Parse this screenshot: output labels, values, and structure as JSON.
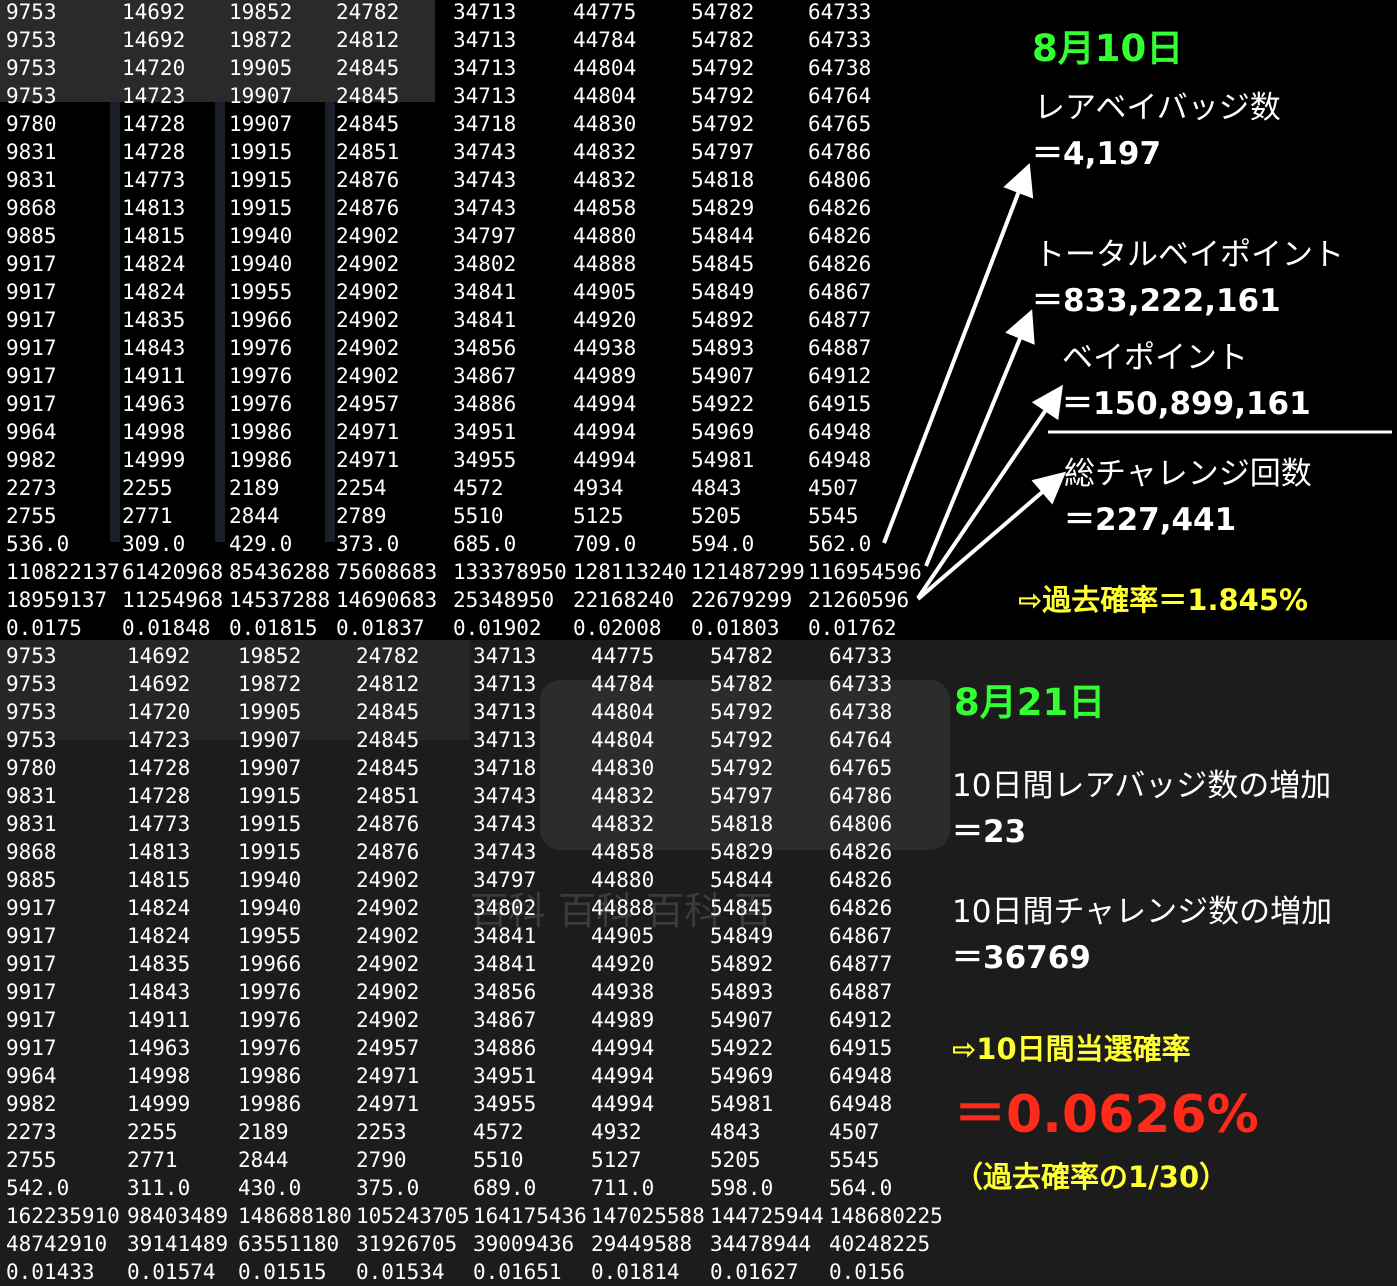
{
  "top_table": {
    "rows": [
      [
        "9753",
        "14692",
        "19852",
        "24782",
        "34713",
        "44775",
        "54782",
        "64733"
      ],
      [
        "9753",
        "14692",
        "19872",
        "24812",
        "34713",
        "44784",
        "54782",
        "64733"
      ],
      [
        "9753",
        "14720",
        "19905",
        "24845",
        "34713",
        "44804",
        "54792",
        "64738"
      ],
      [
        "9753",
        "14723",
        "19907",
        "24845",
        "34713",
        "44804",
        "54792",
        "64764"
      ],
      [
        "9780",
        "14728",
        "19907",
        "24845",
        "34718",
        "44830",
        "54792",
        "64765"
      ],
      [
        "9831",
        "14728",
        "19915",
        "24851",
        "34743",
        "44832",
        "54797",
        "64786"
      ],
      [
        "9831",
        "14773",
        "19915",
        "24876",
        "34743",
        "44832",
        "54818",
        "64806"
      ],
      [
        "9868",
        "14813",
        "19915",
        "24876",
        "34743",
        "44858",
        "54829",
        "64826"
      ],
      [
        "9885",
        "14815",
        "19940",
        "24902",
        "34797",
        "44880",
        "54844",
        "64826"
      ],
      [
        "9917",
        "14824",
        "19940",
        "24902",
        "34802",
        "44888",
        "54845",
        "64826"
      ],
      [
        "9917",
        "14824",
        "19955",
        "24902",
        "34841",
        "44905",
        "54849",
        "64867"
      ],
      [
        "9917",
        "14835",
        "19966",
        "24902",
        "34841",
        "44920",
        "54892",
        "64877"
      ],
      [
        "9917",
        "14843",
        "19976",
        "24902",
        "34856",
        "44938",
        "54893",
        "64887"
      ],
      [
        "9917",
        "14911",
        "19976",
        "24902",
        "34867",
        "44989",
        "54907",
        "64912"
      ],
      [
        "9917",
        "14963",
        "19976",
        "24957",
        "34886",
        "44994",
        "54922",
        "64915"
      ],
      [
        "9964",
        "14998",
        "19986",
        "24971",
        "34951",
        "44994",
        "54969",
        "64948"
      ],
      [
        "9982",
        "14999",
        "19986",
        "24971",
        "34955",
        "44994",
        "54981",
        "64948"
      ],
      [
        "2273",
        "2255",
        "2189",
        "2254",
        "4572",
        "4934",
        "4843",
        "4507"
      ],
      [
        "2755",
        "2771",
        "2844",
        "2789",
        "5510",
        "5125",
        "5205",
        "5545"
      ],
      [
        "536.0",
        "309.0",
        "429.0",
        "373.0",
        "685.0",
        "709.0",
        "594.0",
        "562.0"
      ],
      [
        "110822137",
        "61420968",
        "85436288",
        "75608683",
        "133378950",
        "128113240",
        "121487299",
        "116954596"
      ],
      [
        "18959137",
        "11254968",
        "14537288",
        "14690683",
        "25348950",
        "22168240",
        "22679299",
        "21260596"
      ],
      [
        "0.0175",
        "0.01848",
        "0.01815",
        "0.01837",
        "0.01902",
        "0.02008",
        "0.01803",
        "0.01762"
      ]
    ]
  },
  "bottom_table": {
    "rows": [
      [
        "9753",
        "14692",
        "19852",
        "24782",
        "34713",
        "44775",
        "54782",
        "64733"
      ],
      [
        "9753",
        "14692",
        "19872",
        "24812",
        "34713",
        "44784",
        "54782",
        "64733"
      ],
      [
        "9753",
        "14720",
        "19905",
        "24845",
        "34713",
        "44804",
        "54792",
        "64738"
      ],
      [
        "9753",
        "14723",
        "19907",
        "24845",
        "34713",
        "44804",
        "54792",
        "64764"
      ],
      [
        "9780",
        "14728",
        "19907",
        "24845",
        "34718",
        "44830",
        "54792",
        "64765"
      ],
      [
        "9831",
        "14728",
        "19915",
        "24851",
        "34743",
        "44832",
        "54797",
        "64786"
      ],
      [
        "9831",
        "14773",
        "19915",
        "24876",
        "34743",
        "44832",
        "54818",
        "64806"
      ],
      [
        "9868",
        "14813",
        "19915",
        "24876",
        "34743",
        "44858",
        "54829",
        "64826"
      ],
      [
        "9885",
        "14815",
        "19940",
        "24902",
        "34797",
        "44880",
        "54844",
        "64826"
      ],
      [
        "9917",
        "14824",
        "19940",
        "24902",
        "34802",
        "44888",
        "54845",
        "64826"
      ],
      [
        "9917",
        "14824",
        "19955",
        "24902",
        "34841",
        "44905",
        "54849",
        "64867"
      ],
      [
        "9917",
        "14835",
        "19966",
        "24902",
        "34841",
        "44920",
        "54892",
        "64877"
      ],
      [
        "9917",
        "14843",
        "19976",
        "24902",
        "34856",
        "44938",
        "54893",
        "64887"
      ],
      [
        "9917",
        "14911",
        "19976",
        "24902",
        "34867",
        "44989",
        "54907",
        "64912"
      ],
      [
        "9917",
        "14963",
        "19976",
        "24957",
        "34886",
        "44994",
        "54922",
        "64915"
      ],
      [
        "9964",
        "14998",
        "19986",
        "24971",
        "34951",
        "44994",
        "54969",
        "64948"
      ],
      [
        "9982",
        "14999",
        "19986",
        "24971",
        "34955",
        "44994",
        "54981",
        "64948"
      ],
      [
        "2273",
        "2255",
        "2189",
        "2253",
        "4572",
        "4932",
        "4843",
        "4507"
      ],
      [
        "2755",
        "2771",
        "2844",
        "2790",
        "5510",
        "5127",
        "5205",
        "5545"
      ],
      [
        "542.0",
        "311.0",
        "430.0",
        "375.0",
        "689.0",
        "711.0",
        "598.0",
        "564.0"
      ],
      [
        "162235910",
        "98403489",
        "148688180",
        "105243705",
        "164175436",
        "147025588",
        "144725944",
        "148680225"
      ],
      [
        "48742910",
        "39141489",
        "63551180",
        "31926705",
        "39009436",
        "29449588",
        "34478944",
        "40248225"
      ],
      [
        "0.01433",
        "0.01574",
        "0.01515",
        "0.01534",
        "0.01651",
        "0.01814",
        "0.01627",
        "0.0156"
      ]
    ]
  },
  "top_annotations": {
    "date": "8月10日",
    "rare_badge_label": "レアベイバッジ数",
    "rare_badge_value": "＝4,197",
    "total_points_label": "トータルベイポイント",
    "total_points_value": "＝833,222,161",
    "points_label": "ベイポイント",
    "points_value": "＝150,899,161",
    "challenges_label": "総チャレンジ回数",
    "challenges_value": "＝227,441",
    "past_prob": "⇨過去確率＝1.845%"
  },
  "bottom_annotations": {
    "date": "8月21日",
    "rare_increase_label": "10日間レアバッジ数の増加",
    "rare_increase_value": "＝23",
    "challenge_increase_label": "10日間チャレンジ数の増加",
    "challenge_increase_value": "＝36769",
    "win_rate_label": "⇨10日間当選確率",
    "win_rate_value": "＝0.0626%",
    "note": "（過去確率の1/30）"
  },
  "colors": {
    "green": "#33ff33",
    "yellow": "#ffff33",
    "red": "#ff2a1a",
    "top_bg": "#000000",
    "bottom_bg": "#1c1c1c"
  }
}
